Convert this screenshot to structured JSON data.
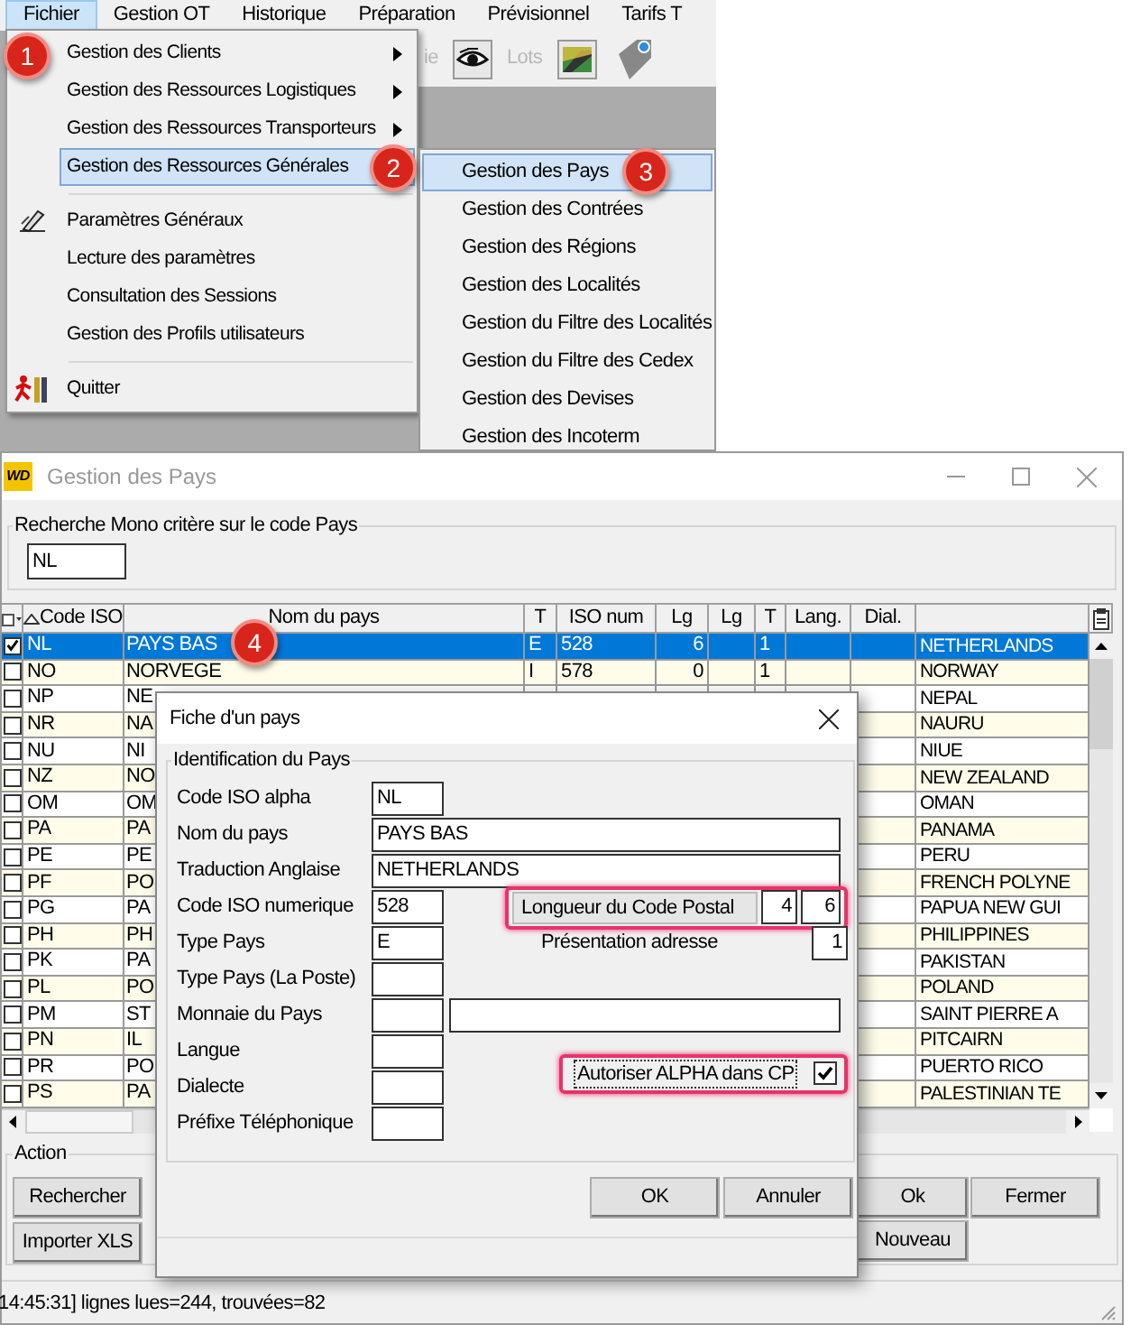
{
  "menubar": [
    {
      "label": "Fichier",
      "selected": true
    },
    {
      "label": "Gestion OT",
      "selected": false
    },
    {
      "label": "Historique",
      "selected": false
    },
    {
      "label": "Préparation",
      "selected": false
    },
    {
      "label": "Prévisionnel",
      "selected": false
    },
    {
      "label": "Tarifs T",
      "selected": false
    }
  ],
  "toolbar": [
    {
      "kind": "text",
      "label": "ie"
    },
    {
      "kind": "eye"
    },
    {
      "kind": "text",
      "label": "Lots"
    },
    {
      "kind": "road"
    },
    {
      "kind": "tag"
    }
  ],
  "menu": {
    "items": [
      {
        "kind": "item",
        "label": "Gestion des Clients",
        "submenu": true,
        "selected": false
      },
      {
        "kind": "item",
        "label": "Gestion des Ressources Logistiques",
        "submenu": true,
        "selected": false
      },
      {
        "kind": "item",
        "label": "Gestion des Ressources Transporteurs",
        "submenu": true,
        "selected": false
      },
      {
        "kind": "item",
        "label": "Gestion des Ressources Générales",
        "submenu": true,
        "selected": true
      },
      {
        "kind": "separator"
      },
      {
        "kind": "item",
        "label": "Paramètres Généraux",
        "submenu": false,
        "selected": false
      },
      {
        "kind": "item",
        "label": "Lecture des paramètres",
        "submenu": false,
        "selected": false
      },
      {
        "kind": "item",
        "label": "Consultation des Sessions",
        "submenu": false,
        "selected": false
      },
      {
        "kind": "item",
        "label": "Gestion des Profils utilisateurs",
        "submenu": false,
        "selected": false
      },
      {
        "kind": "separator"
      },
      {
        "kind": "item",
        "label": "Quitter",
        "submenu": false,
        "selected": false
      }
    ]
  },
  "submenu": {
    "items": [
      {
        "label": "Gestion des Pays",
        "selected": true
      },
      {
        "label": "Gestion des Contrées",
        "selected": false
      },
      {
        "label": "Gestion des Régions",
        "selected": false
      },
      {
        "label": "Gestion des Localités",
        "selected": false
      },
      {
        "label": "Gestion du Filtre des Localités",
        "selected": false
      },
      {
        "label": "Gestion du Filtre des Cedex",
        "selected": false
      },
      {
        "label": "Gestion des Devises",
        "selected": false
      },
      {
        "label": "Gestion des Incoterm",
        "selected": false
      }
    ]
  },
  "window": {
    "app_icon": "WD",
    "title": "Gestion des Pays",
    "search": {
      "label": "Recherche Mono critère sur le code Pays",
      "value": "NL"
    },
    "table": {
      "columns": [
        "Code ISO",
        "Nom du pays",
        "T",
        "ISO num",
        "Lg",
        "Lg",
        "T",
        "Lang.",
        "Dial."
      ],
      "rows": [
        {
          "checked": true,
          "selected": true,
          "code": "NL",
          "name": "PAYS BAS",
          "type": "E",
          "iso_num": "528",
          "length": "6",
          "t": "1",
          "english": "NETHERLANDS"
        },
        {
          "checked": false,
          "selected": false,
          "code": "NO",
          "name": "NORVEGE",
          "type": "I",
          "iso_num": "578",
          "length": "0",
          "t": "1",
          "english": "NORWAY"
        },
        {
          "checked": false,
          "selected": false,
          "code": "NP",
          "name": "NE",
          "english": "NEPAL"
        },
        {
          "checked": false,
          "selected": false,
          "code": "NR",
          "name": "NA",
          "english": "NAURU"
        },
        {
          "checked": false,
          "selected": false,
          "code": "NU",
          "name": "NI",
          "english": "NIUE"
        },
        {
          "checked": false,
          "selected": false,
          "code": "NZ",
          "name": "NO",
          "english": "NEW ZEALAND"
        },
        {
          "checked": false,
          "selected": false,
          "code": "OM",
          "name": "OM",
          "english": "OMAN"
        },
        {
          "checked": false,
          "selected": false,
          "code": "PA",
          "name": "PA",
          "english": "PANAMA"
        },
        {
          "checked": false,
          "selected": false,
          "code": "PE",
          "name": "PE",
          "english": "PERU"
        },
        {
          "checked": false,
          "selected": false,
          "code": "PF",
          "name": "PO",
          "english": "FRENCH POLYNE"
        },
        {
          "checked": false,
          "selected": false,
          "code": "PG",
          "name": "PA",
          "english": "PAPUA NEW GUI"
        },
        {
          "checked": false,
          "selected": false,
          "code": "PH",
          "name": "PH",
          "english": "PHILIPPINES"
        },
        {
          "checked": false,
          "selected": false,
          "code": "PK",
          "name": "PA",
          "english": "PAKISTAN"
        },
        {
          "checked": false,
          "selected": false,
          "code": "PL",
          "name": "PO",
          "english": "POLAND"
        },
        {
          "checked": false,
          "selected": false,
          "code": "PM",
          "name": "ST",
          "english": "SAINT PIERRE A"
        },
        {
          "checked": false,
          "selected": false,
          "code": "PN",
          "name": "IL",
          "english": "PITCAIRN"
        },
        {
          "checked": false,
          "selected": false,
          "code": "PR",
          "name": "PO",
          "english": "PUERTO RICO"
        },
        {
          "checked": false,
          "selected": false,
          "code": "PS",
          "name": "PA",
          "english": "PALESTINIAN TE"
        }
      ]
    },
    "action": {
      "label": "Action",
      "left_buttons": [
        "Rechercher",
        "Importer XLS"
      ],
      "right_buttons": [
        "Ok",
        "Fermer",
        "Nouveau"
      ]
    },
    "status_bar": "14:45:31] lignes lues=244, trouvées=82"
  },
  "dialog": {
    "title": "Fiche d'un pays",
    "group": "Identification du Pays",
    "fields": [
      {
        "kind": "long",
        "label": "Code ISO alpha",
        "value": "NL"
      },
      {
        "kind": "long_value",
        "label": "Nom du pays",
        "value": "PAYS BAS"
      },
      {
        "kind": "long_value",
        "label": "Traduction Anglaise",
        "value": "NETHERLANDS"
      },
      {
        "kind": "short",
        "label": "Code ISO numerique",
        "value": "528"
      },
      {
        "kind": "short",
        "label": "Type Pays",
        "value": "E"
      },
      {
        "kind": "short",
        "label": "Type Pays (La Poste)"
      },
      {
        "kind": "double",
        "label": "Monnaie du Pays"
      },
      {
        "kind": "short",
        "label": "Langue"
      },
      {
        "kind": "short",
        "label": "Dialecte"
      },
      {
        "kind": "short",
        "label": "Préfixe Téléphonique"
      }
    ],
    "postal_code_length": {
      "label": "Longueur du Code Postal",
      "min": "4",
      "max": "6"
    },
    "address_format": {
      "label": "Présentation adresse",
      "value": "1"
    },
    "alpha_in_postcode": {
      "label": "Autoriser ALPHA dans CP",
      "checked": true
    },
    "buttons": [
      "OK",
      "Annuler"
    ]
  },
  "badges": [
    "1",
    "2",
    "3",
    "4"
  ]
}
